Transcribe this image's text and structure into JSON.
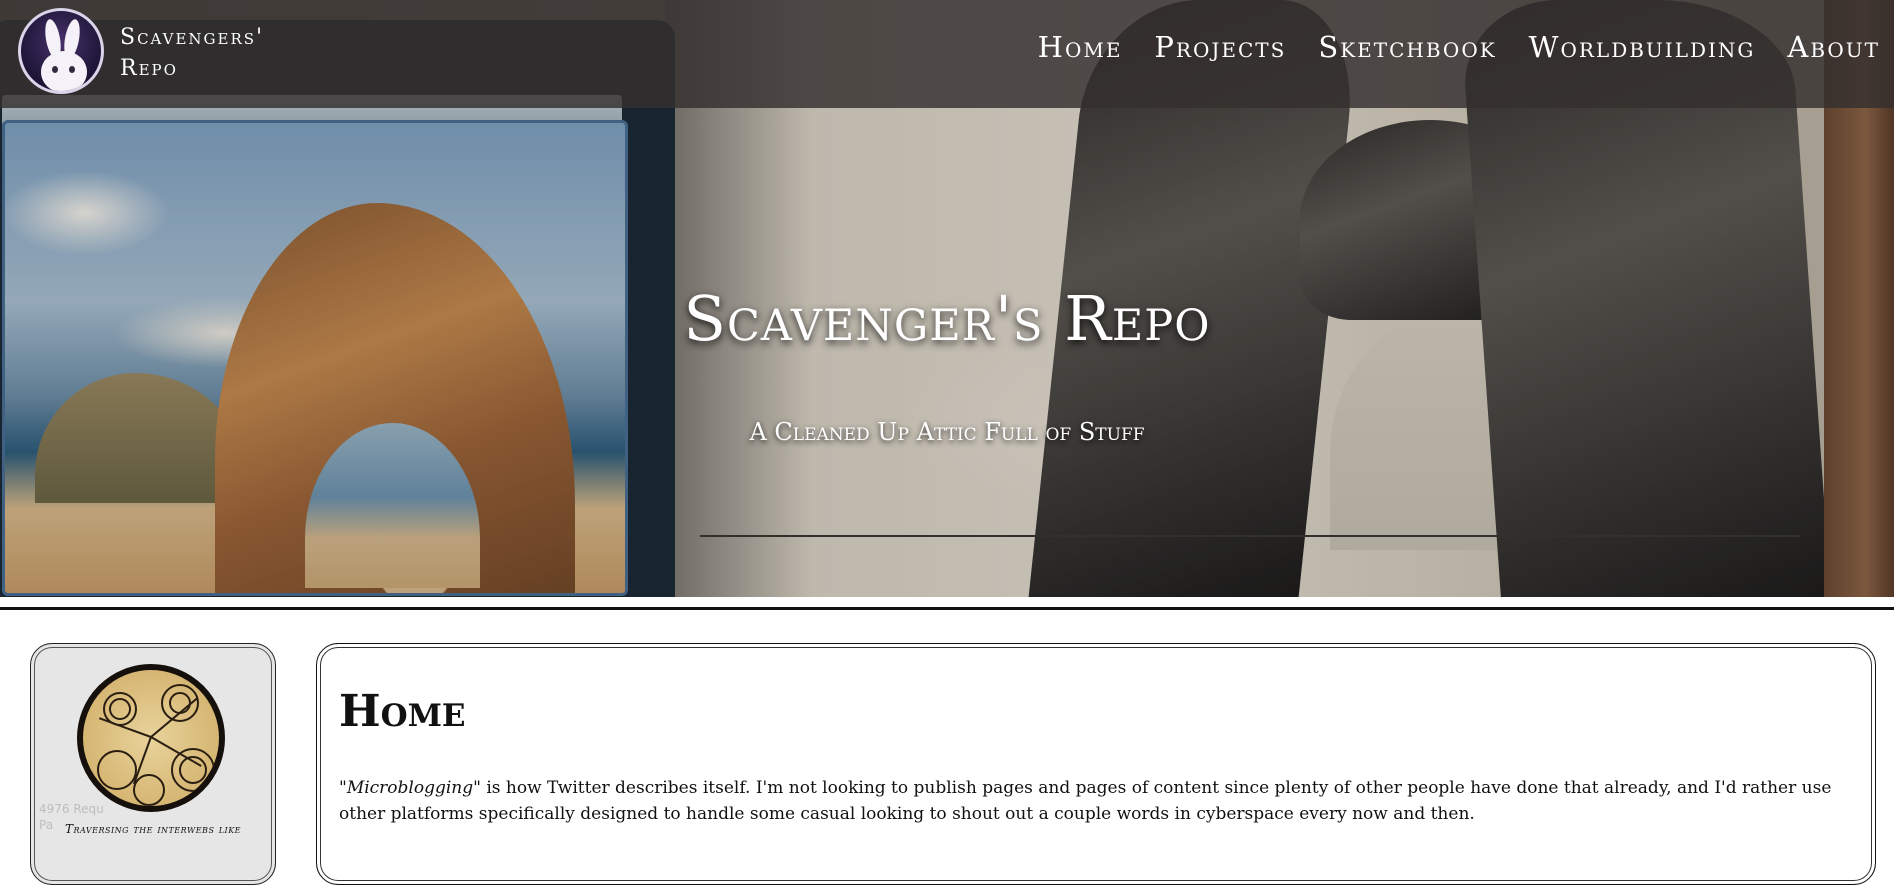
{
  "site": {
    "brand_line1": "Scavengers'",
    "brand_line2": "Repo",
    "hero_title": "Scavenger's Repo",
    "hero_subtitle": "A Cleaned Up Attic Full of Stuff"
  },
  "nav": {
    "items": [
      {
        "label": "Home",
        "icon": "none"
      },
      {
        "label": "Projects",
        "icon": "none"
      },
      {
        "label": "Sketchbook",
        "icon": "none"
      },
      {
        "label": "Worldbuilding",
        "icon": "none"
      },
      {
        "label": "About",
        "icon": "none"
      }
    ]
  },
  "sidebar": {
    "counter_line1": "4976 Requ",
    "counter_line2": "Pa",
    "caption": "Traversing the interwebs like"
  },
  "main": {
    "title": "Home",
    "intro_em": "\"Microblogging\"",
    "intro_rest": " is how Twitter describes itself. I'm not looking to publish pages and pages of content since plenty of other people have done that already, and I'd rather use other platforms specifically designed to handle some casual looking to shout out a couple words in cyberspace every now and then."
  },
  "colors": {
    "nav_bg": "#34302e",
    "divider": "#111111",
    "sidebar_bg": "#e6e6e6",
    "text": "#111111"
  }
}
